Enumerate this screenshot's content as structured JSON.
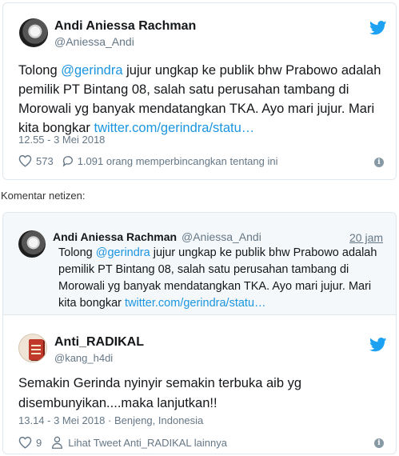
{
  "tweet1": {
    "name": "Andi Aniessa Rachman",
    "handle": "@Aniessa_Andi",
    "text_line1_prefix": "Tolong ",
    "mention": "@gerindra",
    "text_line1_suffix": " jujur ungkap ke publik bhw Prabowo adalah",
    "text_line2": "pemilik PT Bintang 08, salah satu perusahan tambang di",
    "text_line3": "Morowali yg banyak mendatangkan TKA. Ayo mari jujur. Mari",
    "text_line4_prefix": "kita bongkar ",
    "link": "twitter.com/gerindra/statu…",
    "timestamp": "12.55 - 3 Mei 2018",
    "likes": "573",
    "discussion": "1.091 orang memperbincangkan tentang ini",
    "brand_color": "#1da1f2"
  },
  "comment_label": "Komentar netizen:",
  "quote": {
    "name": "Andi Aniessa Rachman",
    "handle": "@Aniessa_Andi",
    "time": "20 jam",
    "line1_prefix": "Tolong ",
    "mention": "@gerindra",
    "line1_suffix": " jujur ungkap ke publik bhw Prabowo adalah",
    "line2": "pemilik PT Bintang 08, salah satu perusahan tambang di",
    "line3": "Morowali yg banyak mendatangkan TKA. Ayo mari jujur. Mari",
    "line4_prefix": "kita bongkar ",
    "link": "twitter.com/gerindra/statu…"
  },
  "tweet2": {
    "name": "Anti_RADIKAL",
    "handle": "@kang_h4di",
    "text_line1": "Semakin Gerinda nyinyir semakin terbuka aib yg",
    "text_line2": "disembunyikan....maka lanjutkan!!",
    "timestamp": "13.14 - 3 Mei 2018 · Benjeng, Indonesia",
    "likes": "9",
    "more_link": "Lihat Tweet Anti_RADIKAL lainnya"
  },
  "icons": {
    "bird": "twitter-bird-icon",
    "heart": "heart-icon",
    "comment": "comment-bubble-icon",
    "person": "person-icon",
    "info": "info-icon"
  }
}
